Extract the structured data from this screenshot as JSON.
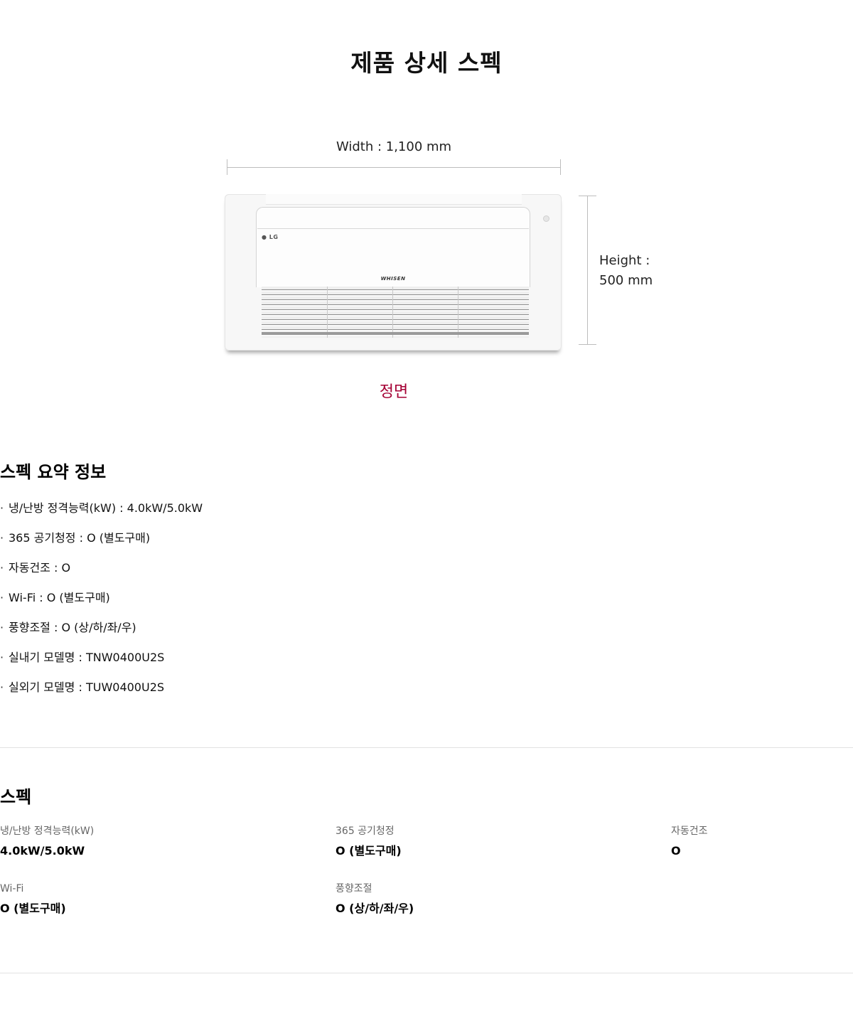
{
  "page_title": "제품 상세 스펙",
  "dimensions": {
    "width_label": "Width : 1,100 mm",
    "height_label_line1": "Height :",
    "height_label_line2": "500 mm",
    "view_label": "정면"
  },
  "product_image": {
    "logo_text": "LG",
    "brand_text": "WHISEN"
  },
  "summary": {
    "title": "스펙 요약 정보",
    "bullet": "·",
    "items": [
      "냉/난방 정격능력(kW) : 4.0kW/5.0kW",
      "365 공기청정 : O (별도구매)",
      "자동건조 : O",
      "Wi-Fi : O (별도구매)",
      "풍향조절 : O (상/하/좌/우)",
      "실내기 모델명 : TNW0400U2S",
      "실외기 모델명 : TUW0400U2S"
    ]
  },
  "specs": {
    "title": "스펙",
    "items": [
      {
        "label": "냉/난방 정격능력(kW)",
        "value": "4.0kW/5.0kW"
      },
      {
        "label": "365 공기청정",
        "value": "O (별도구매)"
      },
      {
        "label": "자동건조",
        "value": "O"
      },
      {
        "label": "Wi-Fi",
        "value": "O (별도구매)"
      },
      {
        "label": "풍향조절",
        "value": "O (상/하/좌/우)"
      }
    ]
  },
  "colors": {
    "accent": "#a50034",
    "divider": "#e2e2e2"
  }
}
